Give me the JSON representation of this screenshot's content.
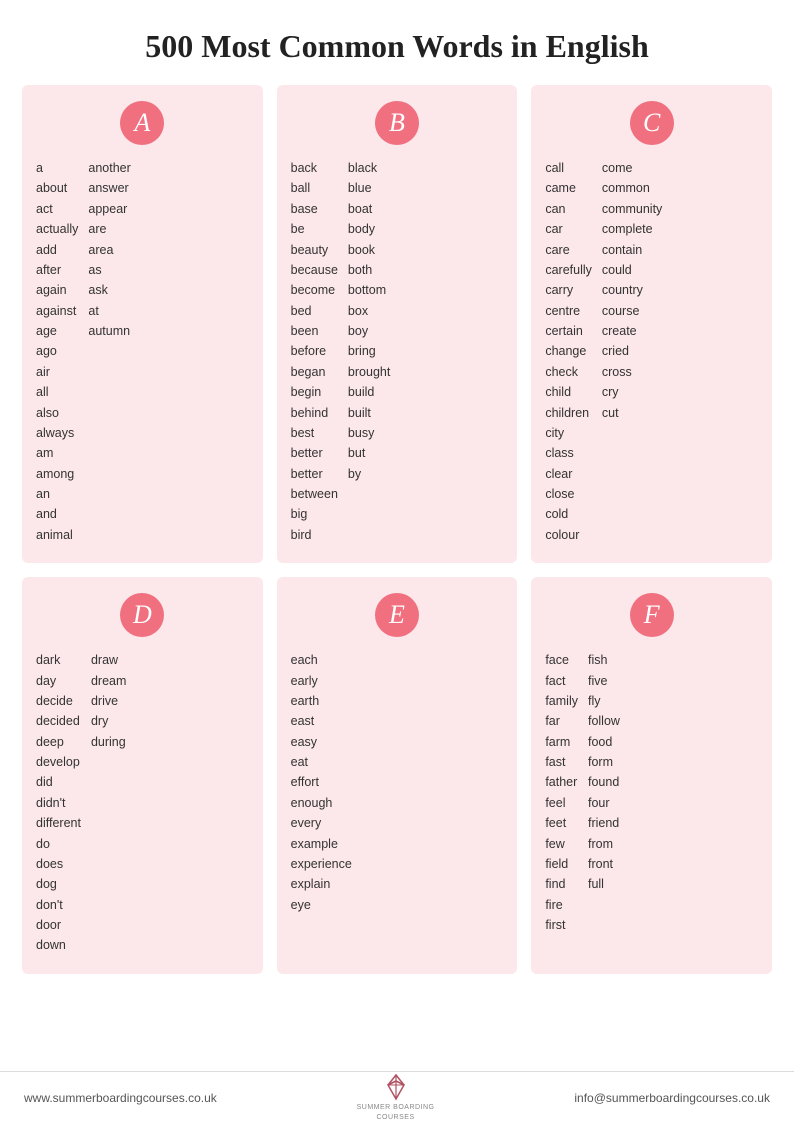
{
  "title": "500 Most Common Words in English",
  "cards": [
    {
      "letter": "A",
      "columns": [
        [
          "a",
          "about",
          "act",
          "actually",
          "add",
          "after",
          "again",
          "against",
          "age",
          "ago",
          "air",
          "all",
          "also",
          "always",
          "am",
          "among",
          "an",
          "and",
          "animal"
        ],
        [
          "another",
          "answer",
          "appear",
          "are",
          "area",
          "as",
          "ask",
          "at",
          "autumn"
        ]
      ]
    },
    {
      "letter": "B",
      "columns": [
        [
          "back",
          "ball",
          "base",
          "be",
          "beauty",
          "because",
          "become",
          "bed",
          "been",
          "before",
          "began",
          "begin",
          "behind",
          "best",
          "better",
          "better",
          "between",
          "big",
          "bird"
        ],
        [
          "black",
          "blue",
          "boat",
          "body",
          "book",
          "both",
          "bottom",
          "box",
          "boy",
          "bring",
          "brought",
          "build",
          "built",
          "busy",
          "but",
          "by"
        ]
      ]
    },
    {
      "letter": "C",
      "columns": [
        [
          "call",
          "came",
          "can",
          "car",
          "care",
          "carefully",
          "carry",
          "centre",
          "certain",
          "change",
          "check",
          "child",
          "children",
          "city",
          "class",
          "clear",
          "close",
          "cold",
          "colour"
        ],
        [
          "come",
          "common",
          "community",
          "complete",
          "contain",
          "could",
          "country",
          "course",
          "create",
          "cried",
          "cross",
          "cry",
          "cut"
        ]
      ]
    },
    {
      "letter": "D",
      "columns": [
        [
          "dark",
          "day",
          "decide",
          "decided",
          "deep",
          "develop",
          "did",
          "didn't",
          "different",
          "do",
          "does",
          "dog",
          "don't",
          "door",
          "down"
        ],
        [
          "draw",
          "dream",
          "drive",
          "dry",
          "during"
        ]
      ]
    },
    {
      "letter": "E",
      "columns": [
        [
          "each",
          "early",
          "earth",
          "east",
          "easy",
          "eat",
          "effort",
          "enough",
          "every",
          "example",
          "experience",
          "explain",
          "eye"
        ]
      ]
    },
    {
      "letter": "F",
      "columns": [
        [
          "face",
          "fact",
          "family",
          "far",
          "farm",
          "fast",
          "father",
          "feel",
          "feet",
          "few",
          "field",
          "find",
          "fire",
          "first"
        ],
        [
          "fish",
          "five",
          "fly",
          "follow",
          "food",
          "form",
          "found",
          "four",
          "friend",
          "from",
          "front",
          "full"
        ]
      ]
    }
  ],
  "footer": {
    "left": "www.summerboardingcourses.co.uk",
    "right": "info@summerboardingcourses.co.uk",
    "logo_line1": "SUMMER BOARDING",
    "logo_line2": "COURSES"
  }
}
